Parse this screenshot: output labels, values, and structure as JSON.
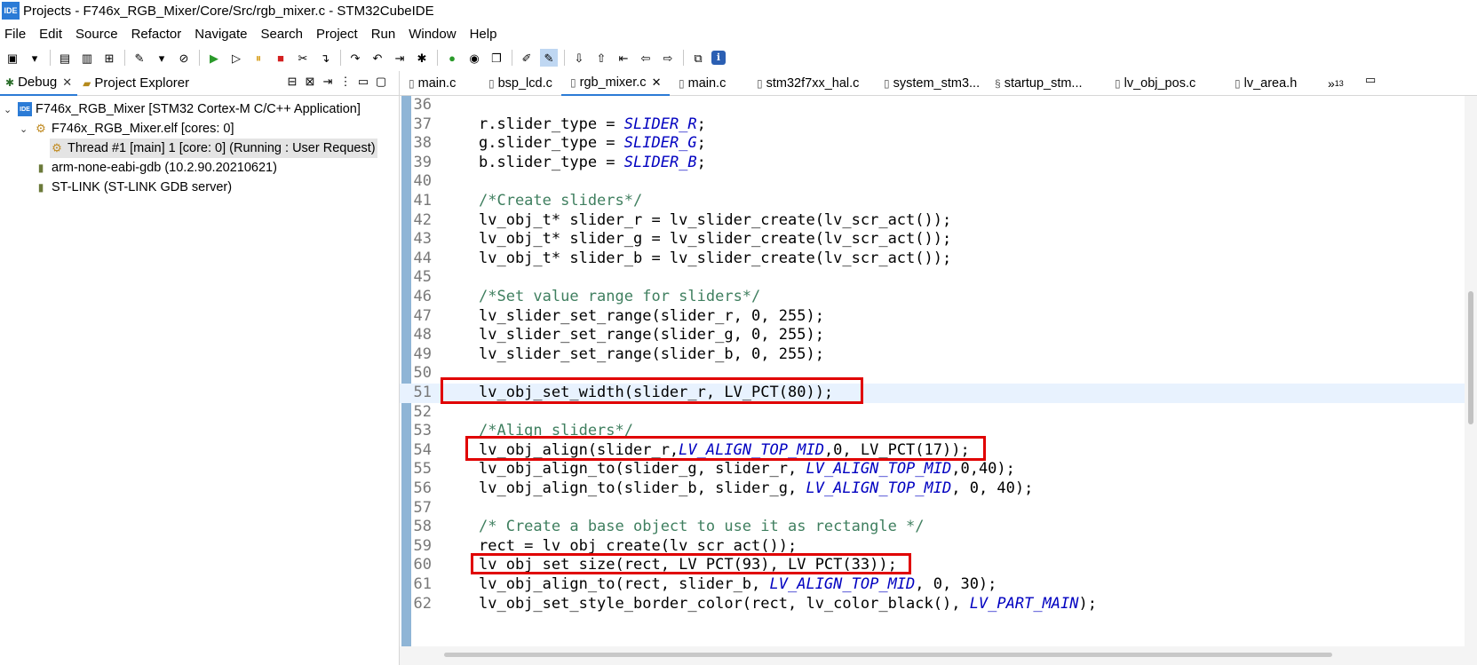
{
  "window": {
    "title": "Projects - F746x_RGB_Mixer/Core/Src/rgb_mixer.c - STM32CubeIDE",
    "logo_text": "IDE"
  },
  "menu": [
    "File",
    "Edit",
    "Source",
    "Refactor",
    "Navigate",
    "Search",
    "Project",
    "Run",
    "Window",
    "Help"
  ],
  "toolbar_icons": [
    {
      "name": "new-icon",
      "glyph": "▣"
    },
    {
      "name": "dropdown-icon",
      "glyph": "▾"
    },
    {
      "name": "save-icon",
      "glyph": "▤"
    },
    {
      "name": "save-all-icon",
      "glyph": "▥"
    },
    {
      "name": "build-config-icon",
      "glyph": "⊞"
    },
    {
      "name": "build-icon",
      "glyph": "✎"
    },
    {
      "name": "dropdown-icon",
      "glyph": "▾"
    },
    {
      "name": "skip-breakpoints-icon",
      "glyph": "⊘"
    },
    {
      "name": "resume-icon",
      "glyph": "▶"
    },
    {
      "name": "step-icon",
      "glyph": "▷"
    },
    {
      "name": "suspend-icon",
      "glyph": "⏸"
    },
    {
      "name": "terminate-icon",
      "glyph": "■"
    },
    {
      "name": "disconnect-icon",
      "glyph": "✂"
    },
    {
      "name": "step-into-icon",
      "glyph": "↴"
    },
    {
      "name": "step-over-icon",
      "glyph": "↷"
    },
    {
      "name": "step-return-icon",
      "glyph": "↶"
    },
    {
      "name": "step-filter-icon",
      "glyph": "⇥"
    },
    {
      "name": "debug-icon",
      "glyph": "✱"
    },
    {
      "name": "run-icon",
      "glyph": "●"
    },
    {
      "name": "external-tools-icon",
      "glyph": "◉"
    },
    {
      "name": "open-folder-icon",
      "glyph": "❐"
    },
    {
      "name": "pin-icon",
      "glyph": "✐"
    },
    {
      "name": "highlight-icon",
      "glyph": "✎"
    },
    {
      "name": "next-annotation-icon",
      "glyph": "⇩"
    },
    {
      "name": "prev-annotation-icon",
      "glyph": "⇧"
    },
    {
      "name": "last-edit-icon",
      "glyph": "⇤"
    },
    {
      "name": "back-icon",
      "glyph": "⇦"
    },
    {
      "name": "forward-icon",
      "glyph": "⇨"
    },
    {
      "name": "open-perspective-icon",
      "glyph": "⧉"
    },
    {
      "name": "info-icon",
      "glyph": "ℹ"
    }
  ],
  "left_panel": {
    "tabs": [
      {
        "label": "Debug",
        "active": true
      },
      {
        "label": "Project Explorer",
        "active": false
      }
    ],
    "tree": [
      {
        "label": "F746x_RGB_Mixer [STM32 Cortex-M C/C++ Application]",
        "icon": "ide-app-icon",
        "indent": 0
      },
      {
        "label": "F746x_RGB_Mixer.elf [cores: 0]",
        "icon": "elf-icon",
        "indent": 1
      },
      {
        "label": "Thread #1 [main] 1 [core: 0] (Running : User Request)",
        "icon": "thread-icon",
        "indent": 2
      },
      {
        "label": "arm-none-eabi-gdb (10.2.90.20210621)",
        "icon": "process-icon",
        "indent": 1
      },
      {
        "label": "ST-LINK (ST-LINK GDB server)",
        "icon": "process-icon",
        "indent": 1
      }
    ]
  },
  "editor": {
    "tabs": [
      {
        "label": "main.c",
        "active": false
      },
      {
        "label": "bsp_lcd.c",
        "active": false
      },
      {
        "label": "rgb_mixer.c",
        "active": true
      },
      {
        "label": "main.c",
        "active": false
      },
      {
        "label": "stm32f7xx_hal.c",
        "active": false
      },
      {
        "label": "system_stm3...",
        "active": false
      },
      {
        "label": "startup_stm...",
        "active": false
      },
      {
        "label": "lv_obj_pos.c",
        "active": false
      },
      {
        "label": "lv_area.h",
        "active": false
      }
    ],
    "overflow_label": "»",
    "overflow_count": "13",
    "lines": [
      {
        "n": "36",
        "segs": []
      },
      {
        "n": "37",
        "segs": [
          {
            "t": "r.slider_type = "
          },
          {
            "t": "SLIDER_R",
            "c": "kw-const"
          },
          {
            "t": ";"
          }
        ]
      },
      {
        "n": "38",
        "segs": [
          {
            "t": "g.slider_type = "
          },
          {
            "t": "SLIDER_G",
            "c": "kw-const"
          },
          {
            "t": ";"
          }
        ]
      },
      {
        "n": "39",
        "segs": [
          {
            "t": "b.slider_type = "
          },
          {
            "t": "SLIDER_B",
            "c": "kw-const"
          },
          {
            "t": ";"
          }
        ]
      },
      {
        "n": "40",
        "segs": []
      },
      {
        "n": "41",
        "segs": [
          {
            "t": "/*Create sliders*/",
            "c": "cmt"
          }
        ]
      },
      {
        "n": "42",
        "segs": [
          {
            "t": "lv_obj_t* slider_r = lv_slider_create(lv_scr_act());"
          }
        ]
      },
      {
        "n": "43",
        "segs": [
          {
            "t": "lv_obj_t* slider_g = lv_slider_create(lv_scr_act());"
          }
        ]
      },
      {
        "n": "44",
        "segs": [
          {
            "t": "lv_obj_t* slider_b = lv_slider_create(lv_scr_act());"
          }
        ]
      },
      {
        "n": "45",
        "segs": []
      },
      {
        "n": "46",
        "segs": [
          {
            "t": "/*Set value range for sliders*/",
            "c": "cmt"
          }
        ]
      },
      {
        "n": "47",
        "segs": [
          {
            "t": "lv_slider_set_range(slider_r, 0, 255);"
          }
        ]
      },
      {
        "n": "48",
        "segs": [
          {
            "t": "lv_slider_set_range(slider_g, 0, 255);"
          }
        ]
      },
      {
        "n": "49",
        "segs": [
          {
            "t": "lv_slider_set_range(slider_b, 0, 255);"
          }
        ]
      },
      {
        "n": "50",
        "segs": []
      },
      {
        "n": "51",
        "segs": [
          {
            "t": "lv_obj_set_width(slider_r, LV_PCT(80));"
          }
        ],
        "current": true
      },
      {
        "n": "52",
        "segs": []
      },
      {
        "n": "53",
        "segs": [
          {
            "t": "/*Align sliders*/",
            "c": "cmt"
          }
        ]
      },
      {
        "n": "54",
        "segs": [
          {
            "t": "lv_obj_align(slider_r,"
          },
          {
            "t": "LV_ALIGN_TOP_MID",
            "c": "kw-const"
          },
          {
            "t": ",0, LV_PCT(17));"
          }
        ]
      },
      {
        "n": "55",
        "segs": [
          {
            "t": "lv_obj_align_to(slider_g, slider_r, "
          },
          {
            "t": "LV_ALIGN_TOP_MID",
            "c": "kw-const"
          },
          {
            "t": ",0,40);"
          }
        ]
      },
      {
        "n": "56",
        "segs": [
          {
            "t": "lv_obj_align_to(slider_b, slider_g, "
          },
          {
            "t": "LV_ALIGN_TOP_MID",
            "c": "kw-const"
          },
          {
            "t": ", 0, 40);"
          }
        ]
      },
      {
        "n": "57",
        "segs": []
      },
      {
        "n": "58",
        "segs": [
          {
            "t": "/* Create a base object to use it as rectangle */",
            "c": "cmt"
          }
        ]
      },
      {
        "n": "59",
        "segs": [
          {
            "t": "rect = lv_obj_create(lv_scr_act());"
          }
        ]
      },
      {
        "n": "60",
        "segs": [
          {
            "t": "lv_obj_set_size(rect, LV_PCT(93), LV_PCT(33));"
          }
        ]
      },
      {
        "n": "61",
        "segs": [
          {
            "t": "lv_obj_align_to(rect, slider_b, "
          },
          {
            "t": "LV_ALIGN_TOP_MID",
            "c": "kw-const"
          },
          {
            "t": ", 0, 30);"
          }
        ]
      },
      {
        "n": "62",
        "segs": [
          {
            "t": "lv_obj_set_style_border_color(rect, lv_color_black(), "
          },
          {
            "t": "LV_PART_MAIN",
            "c": "kw-const"
          },
          {
            "t": ");"
          }
        ]
      }
    ]
  },
  "colors": {
    "highlight_box": "#e00000",
    "current_line": "#e8f2fe",
    "constant": "#0000c0",
    "comment": "#3f7f5f"
  }
}
